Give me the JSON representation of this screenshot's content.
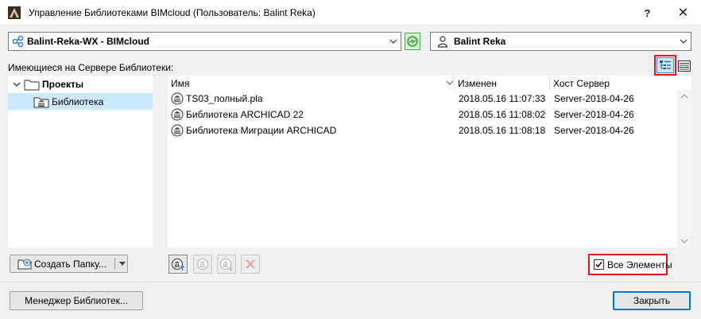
{
  "window": {
    "title": "Управление Библиотеками BIMcloud (Пользователь: Balint Reka)",
    "help_label": "?",
    "close_label": "✕"
  },
  "server_combo": {
    "value": "Balint-Reka-WX - BIMcloud"
  },
  "user_combo": {
    "value": "Balint Reka"
  },
  "available_label": "Имеющиеся на Сервере Библиотеки:",
  "tree": [
    {
      "label": "Проекты",
      "expanded": true
    },
    {
      "label": "Библиотека",
      "selected": true
    }
  ],
  "columns": {
    "name": "Имя",
    "changed": "Изменен",
    "host": "Хост Сервер"
  },
  "rows": [
    {
      "name": "TS03_полный.pla",
      "changed": "2018.05.16 11:07:33",
      "host": "Server-2018-04-26"
    },
    {
      "name": "Библиотека ARCHICAD 22",
      "changed": "2018.05.16 11:08:02",
      "host": "Server-2018-04-26"
    },
    {
      "name": "Библиотека Миграции ARCHICAD",
      "changed": "2018.05.16 11:08:18",
      "host": "Server-2018-04-26"
    }
  ],
  "buttons": {
    "create_folder": "Создать Папку...",
    "library_manager": "Менеджер Библиотек...",
    "close": "Закрыть"
  },
  "all_items": {
    "label": "Все Элементы",
    "checked": true
  },
  "colors": {
    "highlight_red": "#e81123",
    "selection_blue": "#cce8ff",
    "refresh_green": "#52a35a",
    "accent_blue": "#0078d7"
  },
  "icons": [
    "app-icon",
    "bimcloud-server-icon",
    "refresh-icon",
    "user-icon",
    "tree-view-icon",
    "list-view-icon",
    "folder-icon",
    "library-icon",
    "sort-arrow-icon",
    "new-folder-icon",
    "import-library-icon",
    "delete-icon"
  ]
}
